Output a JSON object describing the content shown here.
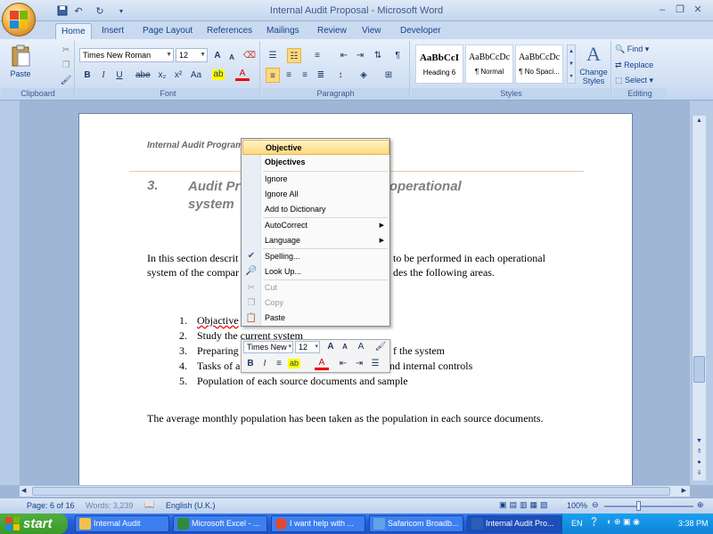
{
  "title_bar": {
    "document_title": "Internal Audit Proposal - Microsoft Word",
    "qat": [
      "save-icon",
      "undo-icon",
      "redo-icon"
    ],
    "window_buttons": [
      "–",
      "❐",
      "✕"
    ]
  },
  "ribbon_tabs": [
    "Home",
    "Insert",
    "Page Layout",
    "References",
    "Mailings",
    "Review",
    "View",
    "Developer"
  ],
  "active_tab": "Home",
  "ribbon": {
    "clipboard": {
      "paste_label": "Paste",
      "group_label": "Clipboard"
    },
    "font": {
      "font_name": "Times New Roman",
      "font_size": "12",
      "group_label": "Font",
      "bold": "B",
      "italic": "I",
      "underline": "U",
      "strike": "abe",
      "subscript": "x₂",
      "superscript": "x²",
      "change_case": "Aa",
      "grow": "A",
      "shrink": "A"
    },
    "paragraph": {
      "group_label": "Paragraph"
    },
    "styles": {
      "items": [
        {
          "preview": "AaBbCcI",
          "name": "Heading 6"
        },
        {
          "preview": "AaBbCcDc",
          "name": "¶ Normal"
        },
        {
          "preview": "AaBbCcDc",
          "name": "¶ No Spaci..."
        }
      ],
      "change_styles": "Change Styles",
      "group_label": "Styles"
    },
    "editing": {
      "find": "Find",
      "replace": "Replace",
      "select": "Select",
      "group_label": "Editing"
    }
  },
  "document": {
    "header_text": "Internal Audit Program",
    "section_number": "3.",
    "section_title_left": "Audit Pr",
    "section_title_right": "in each operational",
    "section_title_line2": "system",
    "para1_line1_left": "In this section descrit",
    "para1_line1_right": "to be performed in each operational",
    "para1_line2_left": "system of the compar",
    "para1_line2_right": "des the following areas.",
    "list": [
      {
        "n": "1.",
        "text": "Objactive"
      },
      {
        "n": "2.",
        "text": "Study the current system"
      },
      {
        "n": "3.",
        "text": "Preparing",
        "tail": "f the system"
      },
      {
        "n": "4.",
        "text": "Tasks of a",
        "tail": "nd internal controls"
      },
      {
        "n": "5.",
        "text": "Population of each source documents and sample"
      }
    ],
    "para2": "The average monthly population has been taken as the population in each source documents."
  },
  "context_menu": {
    "suggestions": [
      "Objective",
      "Objectives"
    ],
    "items": [
      "Ignore",
      "Ignore All",
      "Add to Dictionary"
    ],
    "items2": [
      "AutoCorrect",
      "Language"
    ],
    "items3": [
      "Spelling...",
      "Look Up..."
    ],
    "items4": [
      "Cut",
      "Copy",
      "Paste"
    ]
  },
  "mini_toolbar": {
    "font": "Times New",
    "size": "12"
  },
  "status_bar": {
    "page": "Page: 6 of 16",
    "words": "Words: 3,239",
    "language": "English (U.K.)",
    "zoom": "100%",
    "zoom_level": 1.0
  },
  "taskbar": {
    "start": "start",
    "tasks": [
      {
        "label": "Internal Audit",
        "active": false
      },
      {
        "label": "Microsoft Excel - ...",
        "active": false
      },
      {
        "label": "I want help with ...",
        "active": false
      },
      {
        "label": "Safaricom Broadb...",
        "active": false
      },
      {
        "label": "Internal Audit Pro...",
        "active": true
      }
    ],
    "lang": "EN",
    "time": "3:38 PM"
  },
  "colors": {
    "ribbon": "#d2e0f3",
    "taskbar": "#245edb",
    "highlight": "#ffd87c"
  }
}
